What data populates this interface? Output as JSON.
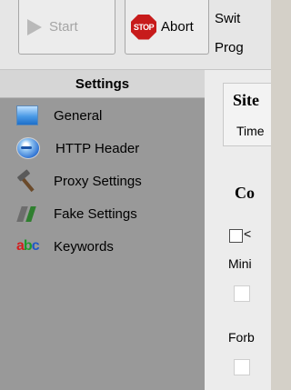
{
  "toolbar": {
    "start_label": "Start",
    "abort_label": "Abort",
    "stop_icon_text": "STOP",
    "side_label_1": "Swit",
    "side_label_2": "Prog"
  },
  "sidebar": {
    "title": "Settings",
    "items": [
      {
        "label": "General",
        "icon": "general-icon"
      },
      {
        "label": "HTTP Header",
        "icon": "http-header-icon"
      },
      {
        "label": "Proxy Settings",
        "icon": "hammer-icon"
      },
      {
        "label": "Fake Settings",
        "icon": "fake-settings-icon"
      },
      {
        "label": "Keywords",
        "icon": "keywords-icon"
      }
    ]
  },
  "content": {
    "site_group_title": "Site",
    "site_field_label": "Time",
    "config_group_title": "Co",
    "checkbox_label": "<",
    "min_label": "Mini",
    "forbid_label": "Forb"
  }
}
